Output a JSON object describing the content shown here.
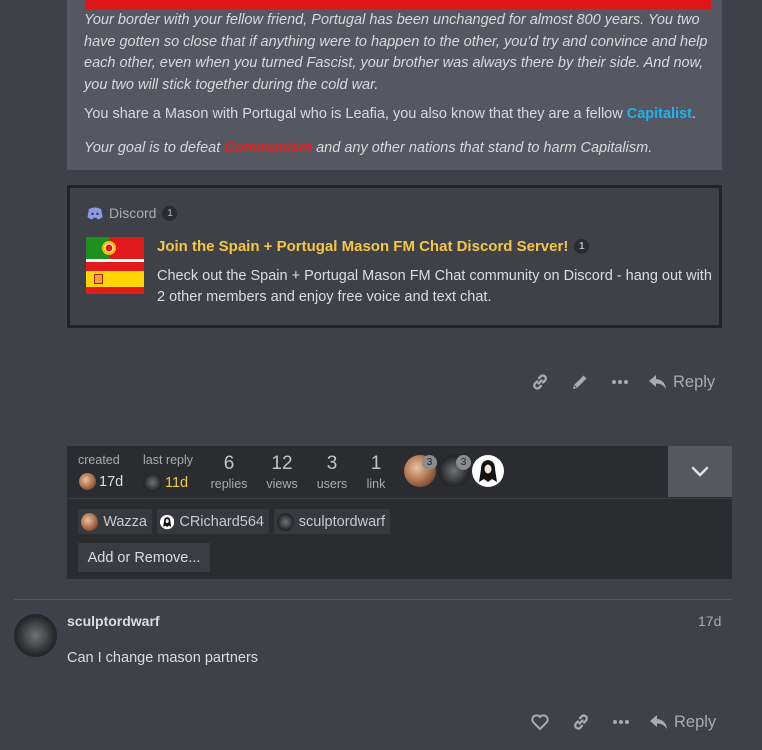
{
  "quote": {
    "para1": "Your border with your fellow friend, Portugal has been unchanged for almost 800 years. You two have gotten so close that if anything were to happen to the other, you'd try and convince and help each other, even when you turned Fascist, your brother was always there by their side. And now, you two will stick together during the cold war.",
    "para2_prefix": "You share a Mason with Portugal who is Leafia, you also know that they are a fellow ",
    "para2_link": "Capitalist",
    "para2_suffix": ".",
    "para3_prefix": "Your goal is to defeat ",
    "para3_word": "Communism",
    "para3_suffix": " and any other nations that stand to harm Capitalism."
  },
  "onebox": {
    "source": "Discord",
    "source_count": "1",
    "title": "Join the Spain + Portugal Mason FM Chat Discord Server!",
    "title_count": "1",
    "description": "Check out the Spain + Portugal Mason FM Chat community on Discord - hang out with 2 other members and enjoy free voice and text chat."
  },
  "post1_actions": {
    "reply": "Reply"
  },
  "topic_map": {
    "created_label": "created",
    "created_value": "17d",
    "last_reply_label": "last reply",
    "last_reply_value": "11d",
    "replies_num": "6",
    "replies_label": "replies",
    "views_num": "12",
    "views_label": "views",
    "users_num": "3",
    "users_label": "users",
    "links_num": "1",
    "links_label": "link",
    "avatar_counts": [
      "3",
      "3"
    ],
    "participants": [
      "Wazza",
      "CRichard564",
      "sculptordwarf"
    ],
    "add_remove": "Add or Remove..."
  },
  "post2": {
    "username": "sculptordwarf",
    "age": "17d",
    "body": "Can I change mason partners",
    "reply": "Reply"
  },
  "colors": {
    "capitalist": "#1fb3ee",
    "communism": "#e81c1c",
    "last_reply_age": "#f6c744",
    "onebox_title": "#f6c744"
  }
}
